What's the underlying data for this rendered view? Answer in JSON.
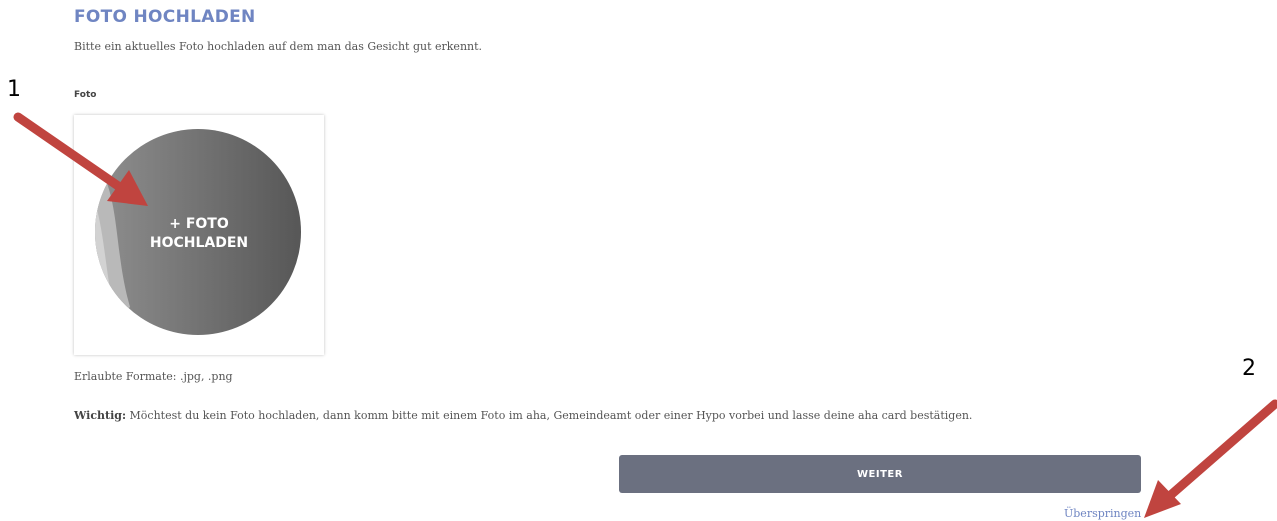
{
  "header": {
    "title": "FOTO HOCHLADEN",
    "intro": "Bitte ein aktuelles Foto hochladen auf dem man das Gesicht gut erkennt."
  },
  "photo_field": {
    "label": "Foto",
    "upload_line1": "+ FOTO",
    "upload_line2": "HOCHLADEN",
    "allowed_formats": "Erlaubte Formate: .jpg, .png"
  },
  "notice": {
    "bold_prefix": "Wichtig:",
    "text": " Möchtest du kein Foto hochladen, dann komm bitte mit einem Foto im aha, Gemeindeamt oder einer Hypo vorbei und lasse deine aha card bestätigen."
  },
  "actions": {
    "next_label": "WEITER",
    "skip_label": "Überspringen"
  },
  "annotations": {
    "marker_1": "1",
    "marker_2": "2",
    "arrow_color": "#c0443f"
  },
  "colors": {
    "accent": "#6f85c2",
    "button_bg": "#6b7080"
  }
}
